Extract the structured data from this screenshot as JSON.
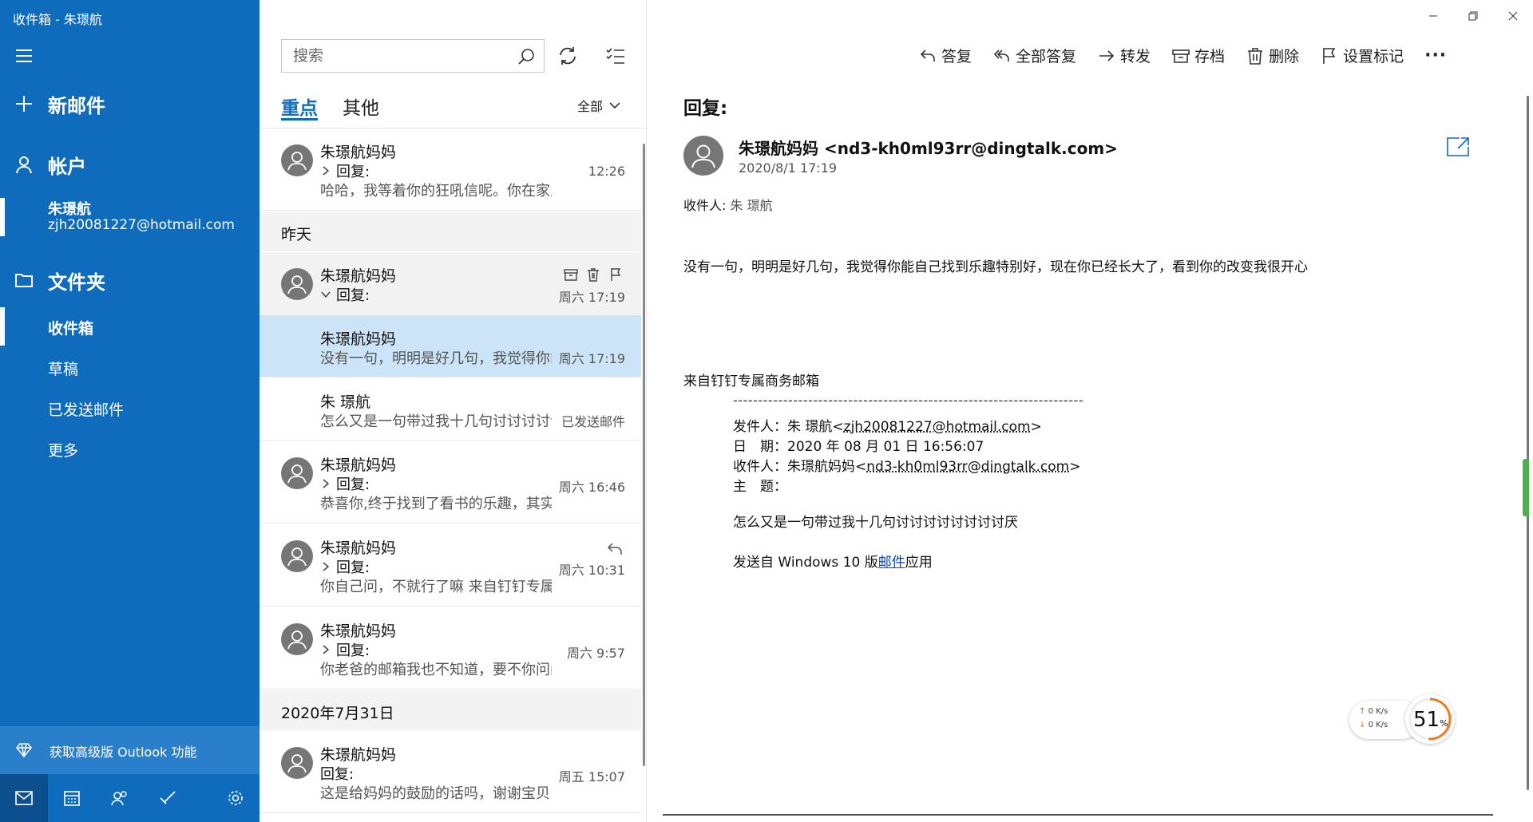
{
  "app": {
    "title": "收件箱 - 朱璟航"
  },
  "sidebar": {
    "new_mail": "新邮件",
    "accounts_label": "帐户",
    "account": {
      "name": "朱璟航",
      "email": "zjh20081227@hotmail.com"
    },
    "folders_label": "文件夹",
    "folders": [
      {
        "label": "收件箱",
        "active": true
      },
      {
        "label": "草稿",
        "active": false
      },
      {
        "label": "已发送邮件",
        "active": false
      },
      {
        "label": "更多",
        "active": false
      }
    ],
    "upgrade": "获取高级版 Outlook 功能",
    "bottom_nav": [
      "mail-icon",
      "calendar-icon",
      "people-icon",
      "todo-icon",
      "settings-icon"
    ]
  },
  "list": {
    "search_placeholder": "搜索",
    "tabs": {
      "focused": "重点",
      "other": "其他"
    },
    "filter": "全部",
    "messages": [
      {
        "sender": "朱璟航妈妈",
        "subject": "回复:",
        "preview": "哈哈，我等着你的狂吼信呢。你在家里都",
        "time": "12:26"
      },
      {
        "sender": "朱璟航妈妈",
        "subject": "回复:",
        "time": "周六 17:19"
      },
      {
        "sender": "朱璟航妈妈",
        "preview": "没有一句，明明是好几句，我觉得你能自己找到乐趣特别好",
        "time": "周六 17:19"
      },
      {
        "sender": "朱 璟航",
        "preview": "怎么又是一句带过我十几句讨讨讨讨讨讨讨讨讨厌",
        "time": "已发送邮件"
      },
      {
        "sender": "朱璟航妈妈",
        "subject": "回复:",
        "preview": "恭喜你,终于找到了看书的乐趣，其实",
        "time": "周六 16:46"
      },
      {
        "sender": "朱璟航妈妈",
        "subject": "回复:",
        "preview": "你自己问，不就行了嘛 来自钉钉专属",
        "time": "周六 10:31"
      },
      {
        "sender": "朱璟航妈妈",
        "subject": "回复:",
        "preview": "你老爸的邮箱我也不知道，要不你问问",
        "time": "周六 9:57"
      },
      {
        "sender": "朱璟航妈妈",
        "subject": "回复:",
        "preview": "这是给妈妈的鼓励的话吗，谢谢宝贝",
        "time": "周五 15:07"
      }
    ],
    "groups": {
      "yesterday": "昨天",
      "jul31": "2020年7月31日"
    }
  },
  "reading": {
    "toolbar": {
      "reply": "答复",
      "reply_all": "全部答复",
      "forward": "转发",
      "archive": "存档",
      "delete": "删除",
      "flag": "设置标记",
      "more": "···"
    },
    "subject": "回复:",
    "from": "朱璟航妈妈 <nd3-kh0ml93rr@dingtalk.com>",
    "date": "2020/8/1 17:19",
    "to_label": "收件人: ",
    "to_value": "朱 璟航",
    "body": "没有一句，明明是好几句，我觉得你能自己找到乐趣特别好，现在你已经长大了，看到你的改变我很开心",
    "signature": "来自钉钉专属商务邮箱",
    "dashes": "----------------------------------------------------------------------",
    "quoted": {
      "from_label": "发件人：朱 璟航<",
      "from_email": "zjh20081227@hotmail.com",
      "from_end": ">",
      "date_line": "日　期：2020 年 08 月 01 日 16:56:07",
      "to_label": "收件人：朱璟航妈妈<",
      "to_email": "nd3-kh0ml93rr@dingtalk.com",
      "to_end": ">",
      "subject_line": "主　题：",
      "body": "怎么又是一句带过我十几句讨讨讨讨讨讨讨讨厌",
      "sig_prefix": "发送自 Windows 10 版",
      "sig_link": "邮件",
      "sig_suffix": "应用"
    }
  },
  "net_widget": {
    "up": "0  K/s",
    "down": "0  K/s",
    "percent": "51",
    "percent_sign": "%"
  },
  "colors": {
    "sidebar": "#0f6cbd",
    "accent": "#0f6cbd",
    "selected": "#cce4f7"
  }
}
